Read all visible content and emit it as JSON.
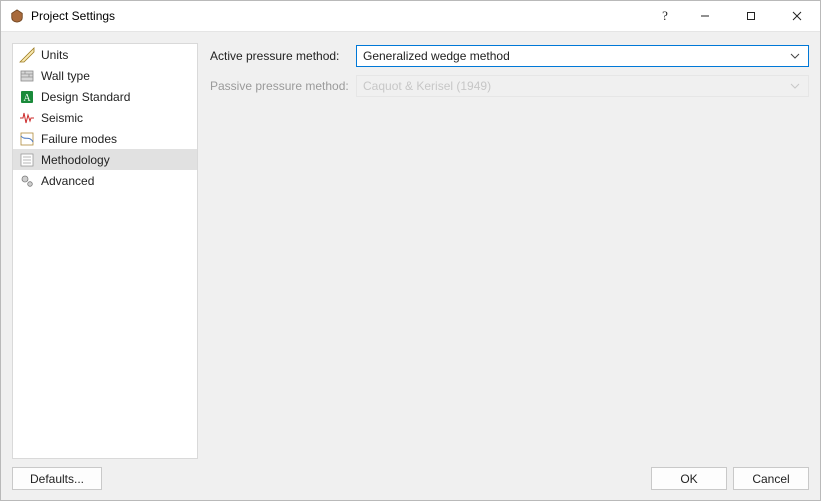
{
  "title": "Project Settings",
  "sidebar": {
    "items": [
      {
        "label": "Units"
      },
      {
        "label": "Wall type"
      },
      {
        "label": "Design Standard"
      },
      {
        "label": "Seismic"
      },
      {
        "label": "Failure modes"
      },
      {
        "label": "Methodology"
      },
      {
        "label": "Advanced"
      }
    ],
    "selected_index": 5
  },
  "main": {
    "active_pressure_label": "Active pressure method:",
    "active_pressure_value": "Generalized wedge method",
    "passive_pressure_label": "Passive pressure method:",
    "passive_pressure_value": "Caquot & Kerisel (1949)"
  },
  "footer": {
    "defaults_label": "Defaults...",
    "ok_label": "OK",
    "cancel_label": "Cancel"
  }
}
